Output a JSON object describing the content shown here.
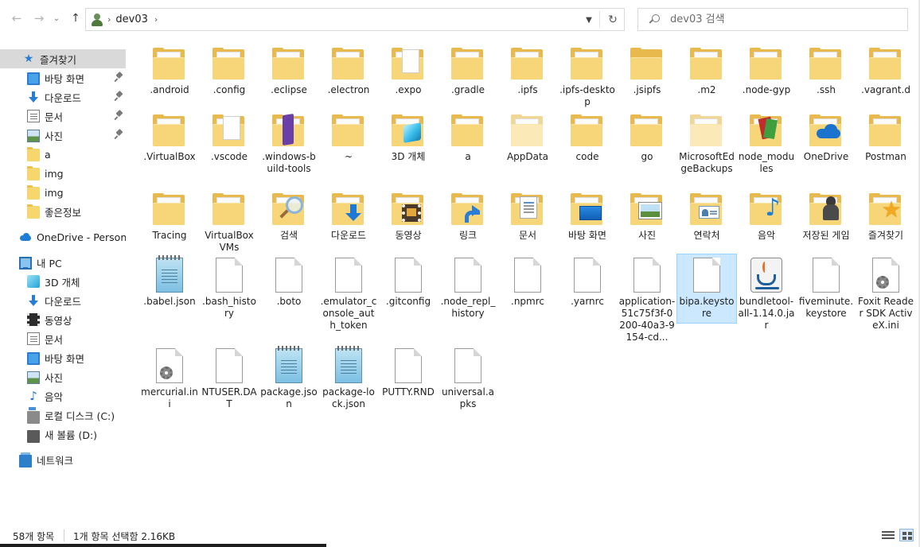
{
  "address": {
    "path_label": "dev03",
    "back_icon": "arrow-left-icon",
    "forward_icon": "arrow-right-icon",
    "up_icon": "arrow-up-icon",
    "refresh_icon": "refresh-icon"
  },
  "search": {
    "placeholder": "dev03 검색"
  },
  "sidebar": {
    "items": [
      {
        "label": "즐겨찾기",
        "icon": "star-icon"
      },
      {
        "label": "바탕 화면",
        "icon": "desktop-icon"
      },
      {
        "label": "다운로드",
        "icon": "download-icon"
      },
      {
        "label": "문서",
        "icon": "document-icon"
      },
      {
        "label": "사진",
        "icon": "picture-icon"
      },
      {
        "label": "a",
        "icon": "folder-icon"
      },
      {
        "label": "img",
        "icon": "folder-icon"
      },
      {
        "label": "img",
        "icon": "folder-icon"
      },
      {
        "label": "좋은정보",
        "icon": "folder-icon"
      },
      {
        "label": "OneDrive - Personal",
        "icon": "cloud-icon"
      },
      {
        "label": "내 PC",
        "icon": "computer-icon"
      },
      {
        "label": "3D 개체",
        "icon": "cube-icon"
      },
      {
        "label": "다운로드",
        "icon": "download-icon"
      },
      {
        "label": "동영상",
        "icon": "video-icon"
      },
      {
        "label": "문서",
        "icon": "document-icon"
      },
      {
        "label": "바탕 화면",
        "icon": "desktop-icon"
      },
      {
        "label": "사진",
        "icon": "picture-icon"
      },
      {
        "label": "음악",
        "icon": "music-icon"
      },
      {
        "label": "로컬 디스크 (C:)",
        "icon": "drive-icon"
      },
      {
        "label": "새 볼륨 (D:)",
        "icon": "drive-icon"
      },
      {
        "label": "네트워크",
        "icon": "network-icon"
      }
    ]
  },
  "files": {
    "row1": [
      ".android",
      ".config",
      ".eclipse",
      ".electron",
      ".expo",
      ".gradle",
      ".ipfs",
      ".ipfs-desktop",
      ".jsipfs",
      ".m2",
      ".node-gyp",
      ".ssh",
      ".vagrant.d"
    ],
    "row2": [
      ".VirtualBox",
      ".vscode",
      ".windows-build-tools",
      "~",
      "3D 개체",
      "a",
      "AppData",
      "code",
      "go",
      "MicrosoftEdgeBackups",
      "node_modules",
      "OneDrive",
      "Postman"
    ],
    "row3": [
      "Tracing",
      "VirtualBox VMs",
      "검색",
      "다운로드",
      "동영상",
      "링크",
      "문서",
      "바탕 화면",
      "사진",
      "연락처",
      "음악",
      "저장된 게임",
      "즐겨찾기"
    ],
    "row4": [
      ".babel.json",
      ".bash_history",
      ".boto",
      ".emulator_console_auth_token",
      ".gitconfig",
      ".node_repl_history",
      ".npmrc",
      ".yarnrc",
      "application-51c75f3f-0200-40a3-9154-cd...",
      "bipa.keystore",
      "bundletool-all-1.14.0.jar",
      "fiveminute.keystore",
      "Foxit Reader SDK ActiveX.ini"
    ],
    "row5": [
      "mercurial.ini",
      "NTUSER.DAT",
      "package.json",
      "package-lock.json",
      "PUTTY.RND",
      "universal.apks"
    ]
  },
  "status": {
    "count": "58개 항목",
    "selection": "1개 항목 선택함 2.16KB"
  }
}
